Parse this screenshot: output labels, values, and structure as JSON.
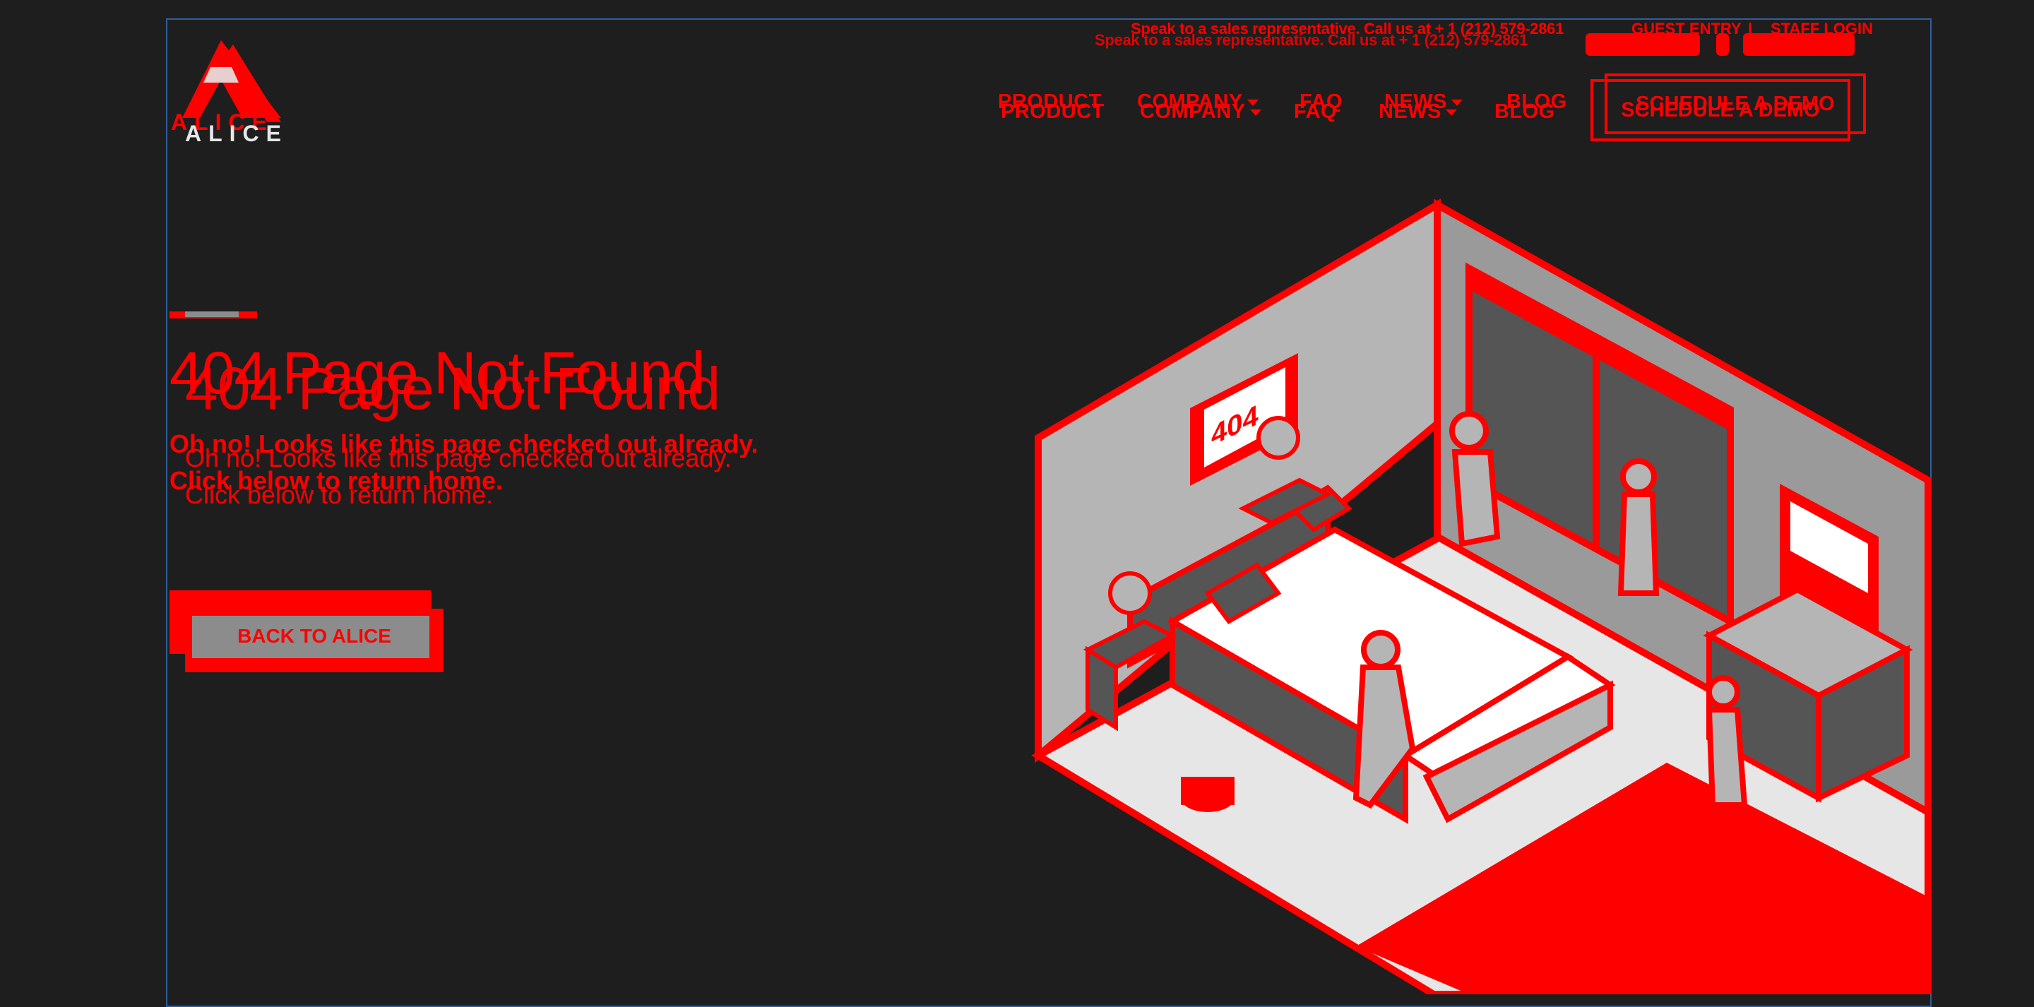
{
  "topbar": {
    "sales_text": "Speak to a sales representative. Call us at + 1 (212) 579-2861",
    "guest_entry": "GUEST ENTRY",
    "separator": "|",
    "staff_login": "STAFF LOGIN"
  },
  "logo": {
    "text": "ALICE"
  },
  "nav": {
    "items": [
      {
        "label": "PRODUCT"
      },
      {
        "label": "COMPANY"
      },
      {
        "label": "FAQ"
      },
      {
        "label": "NEWS"
      },
      {
        "label": "BLOG"
      }
    ],
    "cta": "SCHEDULE A DEMO"
  },
  "hero": {
    "title": "404 Page Not Found",
    "line1": "Oh no! Looks like this page checked out already.",
    "line2": "Click below to return home.",
    "button": "BACK TO ALICE",
    "illustration_label": "404"
  },
  "colors": {
    "background": "#1e1e1e",
    "accent": "#ff0000",
    "gray": "#8c8c8c",
    "light": "#e6e6e6",
    "frame": "#2f5f9a"
  },
  "icons": [
    "caret-down-icon",
    "caret-down-icon"
  ]
}
